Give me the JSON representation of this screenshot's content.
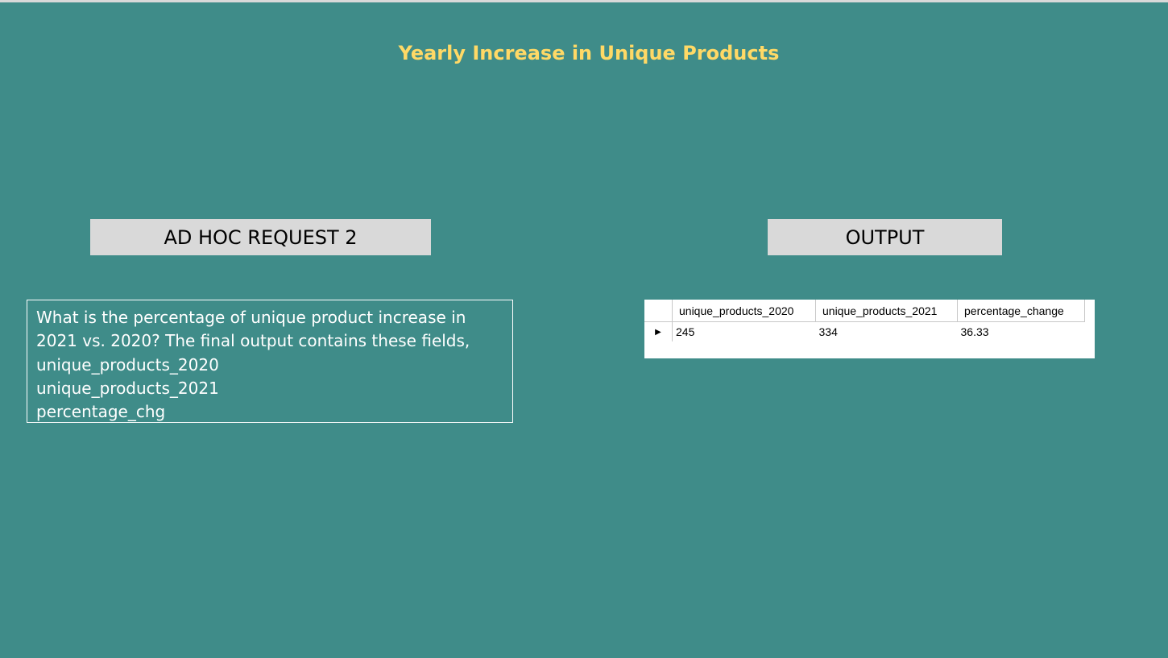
{
  "title": "Yearly Increase in Unique Products",
  "request_label": "AD HOC REQUEST 2",
  "output_label": "OUTPUT",
  "question": {
    "lines": [
      "What is the percentage of unique product increase in",
      "2021 vs. 2020? The final output contains these fields,",
      "unique_products_2020",
      "unique_products_2021",
      "percentage_chg"
    ]
  },
  "result": {
    "columns": [
      "unique_products_2020",
      "unique_products_2021",
      "percentage_change"
    ],
    "rows": [
      [
        "245",
        "334",
        "36.33"
      ]
    ],
    "row_marker": "▶"
  }
}
